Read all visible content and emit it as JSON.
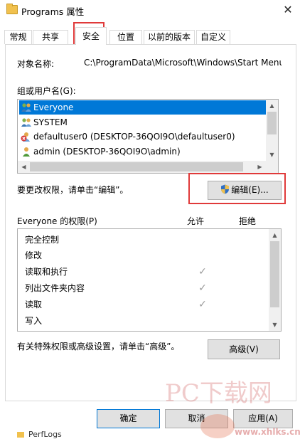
{
  "window": {
    "title": "Programs 属性",
    "close_glyph": "✕"
  },
  "tabs": [
    {
      "label": "常规"
    },
    {
      "label": "共享"
    },
    {
      "label": "安全"
    },
    {
      "label": "位置"
    },
    {
      "label": "以前的版本"
    },
    {
      "label": "自定义"
    }
  ],
  "security": {
    "object_name_label": "对象名称:",
    "object_name_value": "C:\\ProgramData\\Microsoft\\Windows\\Start Menu",
    "group_label": "组或用户名(G):",
    "users": [
      {
        "name": "Everyone",
        "icon": "group-users-icon"
      },
      {
        "name": "SYSTEM",
        "icon": "group-users-icon"
      },
      {
        "name": "defaultuser0 (DESKTOP-36QOI9O\\defaultuser0)",
        "icon": "user-error-icon"
      },
      {
        "name": "admin (DESKTOP-36QOI9O\\admin)",
        "icon": "user-icon"
      }
    ],
    "change_hint": "要更改权限，请单击“编辑”。",
    "edit_button": "编辑(E)...",
    "perm_title": "Everyone 的权限(P)",
    "allow_header": "允许",
    "deny_header": "拒绝",
    "permissions": [
      {
        "name": "完全控制",
        "allow": false
      },
      {
        "name": "修改",
        "allow": false
      },
      {
        "name": "读取和执行",
        "allow": true
      },
      {
        "name": "列出文件夹内容",
        "allow": true
      },
      {
        "name": "读取",
        "allow": true
      },
      {
        "name": "写入",
        "allow": false
      }
    ],
    "advanced_hint": "有关特殊权限或高级设置，请单击“高级”。",
    "advanced_button": "高级(V)"
  },
  "footer": {
    "ok_button": "确定",
    "cancel_button": "取消",
    "apply_button": "应用(A)",
    "background_item": "PerfLogs"
  },
  "watermark": {
    "text": "PC下载网",
    "site": "www.xhlks.cn"
  },
  "colors": {
    "selection": "#0078d7",
    "highlight_box": "#e03a3a"
  }
}
